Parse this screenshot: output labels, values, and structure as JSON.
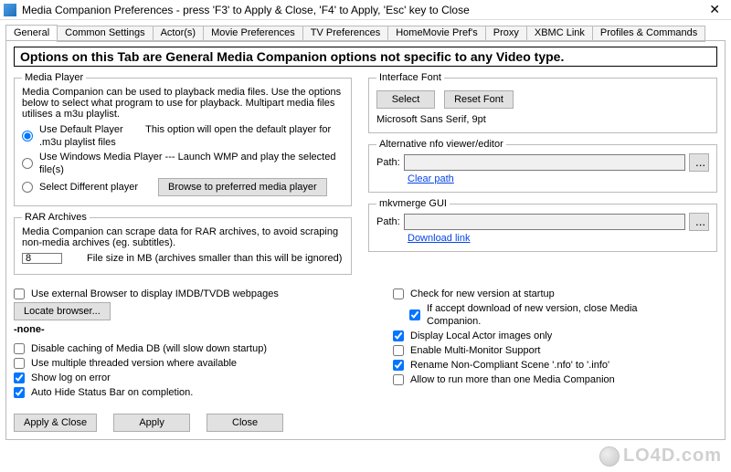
{
  "window": {
    "title": "Media Companion Preferences     -     press 'F3' to Apply & Close, 'F4' to Apply, 'Esc' key to Close",
    "close": "✕"
  },
  "tabs": [
    {
      "label": "General",
      "active": true
    },
    {
      "label": "Common Settings"
    },
    {
      "label": "Actor(s)"
    },
    {
      "label": "Movie Preferences"
    },
    {
      "label": "TV Preferences"
    },
    {
      "label": "HomeMovie Pref's"
    },
    {
      "label": "Proxy"
    },
    {
      "label": "XBMC Link"
    },
    {
      "label": "Profiles & Commands"
    }
  ],
  "banner": "Options on this Tab are General Media Companion options not specific to any Video type.",
  "mediaPlayer": {
    "legend": "Media Player",
    "desc": "Media Companion can be used to playback media files.  Use the options below to select what program to use for playback.   Multipart media files utilises a m3u playlist.",
    "opt1": "Use Default Player",
    "opt1tail": "This option will open the default player for .m3u playlist files",
    "opt2": "Use Windows Media Player --- Launch WMP and play the selected file(s)",
    "opt3": "Select Different player",
    "browse": "Browse to preferred media player"
  },
  "rar": {
    "legend": "RAR Archives",
    "desc": "Media Companion can scrape data for RAR archives, to avoid scraping non-media archives (eg. subtitles).",
    "value": "8",
    "tail": "File size in MB (archives smaller than this will be ignored)"
  },
  "font": {
    "legend": "Interface Font",
    "select": "Select",
    "reset": "Reset Font",
    "current": "Microsoft Sans Serif, 9pt"
  },
  "nfo": {
    "legend": "Alternative nfo viewer/editor",
    "pathLabel": "Path:",
    "path": "",
    "clear": "Clear path",
    "pick": "..."
  },
  "mkv": {
    "legend": "mkvmerge GUI",
    "pathLabel": "Path:",
    "path": "",
    "link": "Download link",
    "pick": "..."
  },
  "left": {
    "externalBrowser": "Use external Browser to display IMDB/TVDB webpages",
    "locate": "Locate browser...",
    "none": "-none-",
    "disableCache": "Disable caching of Media DB (will slow down startup)",
    "multiThread": "Use multiple threaded version where available",
    "showLog": "Show log on error",
    "autoHide": "Auto Hide Status Bar on completion."
  },
  "right": {
    "checkVersion": "Check for new version at startup",
    "ifAccept": "If accept download of new version, close Media Companion.",
    "localActor": "Display Local Actor images only",
    "multiMon": "Enable Multi-Monitor Support",
    "rename": "Rename Non-Compliant Scene '.nfo' to '.info'",
    "allowMulti": "Allow to run more than one Media Companion"
  },
  "buttons": {
    "applyClose": "Apply  &  Close",
    "apply": "Apply",
    "close": "Close"
  },
  "watermark": "LO4D.com"
}
